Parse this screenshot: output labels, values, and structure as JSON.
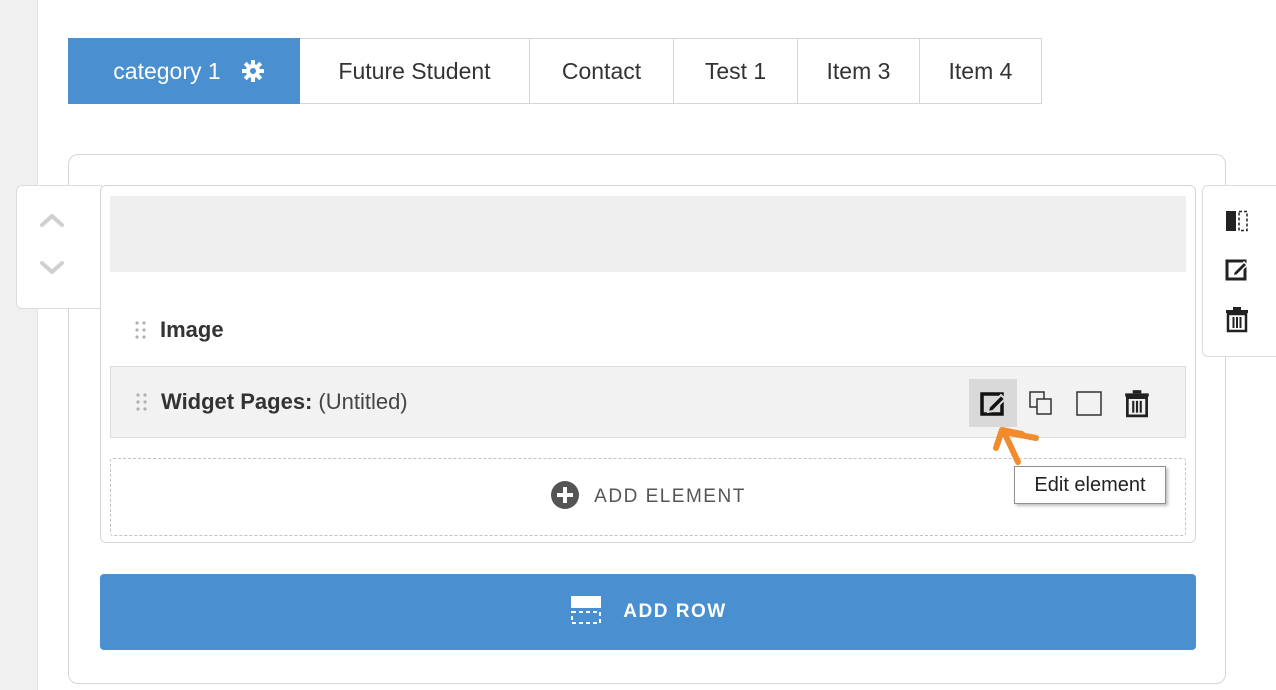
{
  "tabs": [
    {
      "label": "category 1",
      "active": true
    },
    {
      "label": "Future Student"
    },
    {
      "label": "Contact"
    },
    {
      "label": "Test 1"
    },
    {
      "label": "Item 3"
    },
    {
      "label": "Item 4"
    }
  ],
  "icons": {
    "tab_settings": "gear-icon",
    "row_move_up": "chevron-up-icon",
    "row_move_down": "chevron-down-icon",
    "row_tools": [
      "columns-icon",
      "edit-icon",
      "trash-icon"
    ],
    "element_actions": [
      "edit-icon",
      "copy-icon",
      "square-icon",
      "trash-icon"
    ],
    "add_element": "plus-circle-icon",
    "add_row": "add-row-icon"
  },
  "elements": [
    {
      "title": "Image",
      "subtitle": ""
    },
    {
      "title": "Widget Pages:",
      "subtitle": "(Untitled)"
    }
  ],
  "add_element": {
    "label": "ADD ELEMENT"
  },
  "tooltip": {
    "text": "Edit element"
  },
  "add_row": {
    "label": "ADD ROW"
  },
  "colors": {
    "accent": "#4a8fd0",
    "annotation": "#f28a2e"
  }
}
